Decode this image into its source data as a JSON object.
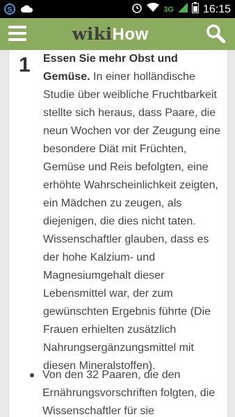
{
  "status_bar": {
    "network": "3G",
    "time": "16:15",
    "icons": [
      "skype-icon",
      "cloud-icon",
      "alarm-icon",
      "wifi-icon",
      "signal-icon",
      "battery-icon"
    ]
  },
  "app_bar": {
    "logo_wiki": "wiki",
    "logo_how": "How",
    "accent_color": "#8bac5e"
  },
  "step": {
    "number": "1",
    "title": "Essen Sie mehr Obst und Gemüse.",
    "body": " In einer holländische Studie über weibliche Fruchtbarkeit stellte sich heraus, dass Paare, die neun Wochen vor der Zeugung eine besondere Diät mit Früchten, Gemüse und Reis befolgten, eine erhöhte Wahrscheinlichkeit zeigten, ein Mädchen zu zeugen, als diejenigen, die dies nicht taten. Wissenschaftler glauben, dass es der hohe Kalzium- und Magnesiumgehalt dieser Lebensmittel war, der zum gewünschten Ergebnis führte (Die Frauen erhielten zusätzlich Nahrungsergänzungsmittel mit diesen Mineralstoffen)."
  },
  "bullets": [
    "Von den 32 Paaren, die den Ernährungsvorschriften folgten, die Wissenschaftler für sie"
  ]
}
